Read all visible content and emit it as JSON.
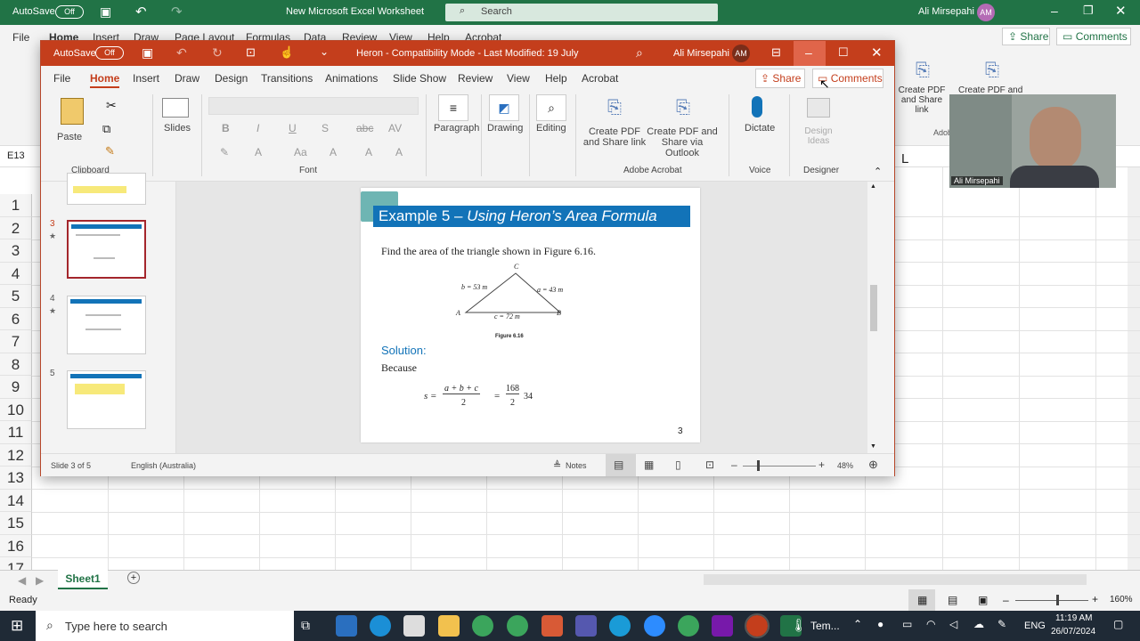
{
  "excel": {
    "autosave_label": "AutoSave",
    "autosave_state": "Off",
    "title": "New Microsoft Excel Worksheet",
    "search_placeholder": "Search",
    "user": "Ali Mirsepahi",
    "user_initials": "AM",
    "menu": [
      "File",
      "Home",
      "Insert",
      "Draw",
      "Page Layout",
      "Formulas",
      "Data",
      "Review",
      "View",
      "Help",
      "Acrobat"
    ],
    "share": "Share",
    "comments": "Comments",
    "acrobat_btn1": "Create PDF and Share link",
    "acrobat_btn2": "Create PDF and",
    "acrobat_group": "Adob",
    "name_box": "E13",
    "col_l": "L",
    "rows": [
      "1",
      "2",
      "3",
      "4",
      "5",
      "6",
      "7",
      "8",
      "9",
      "10",
      "11",
      "12",
      "13",
      "14",
      "15",
      "16",
      "17"
    ],
    "sheet_tab": "Sheet1",
    "status": "Ready",
    "zoom": "160%"
  },
  "ppt": {
    "autosave_label": "AutoSave",
    "autosave_state": "Off",
    "title": "Heron  -  Compatibility Mode  -  Last Modified: 19 July",
    "user": "Ali Mirsepahi",
    "user_initials": "AM",
    "tabs": [
      "File",
      "Home",
      "Insert",
      "Draw",
      "Design",
      "Transitions",
      "Animations",
      "Slide Show",
      "Review",
      "View",
      "Help",
      "Acrobat"
    ],
    "share": "Share",
    "comments": "Comments",
    "ribbon": {
      "paste": "Paste",
      "clipboard": "Clipboard",
      "slides": "Slides",
      "font": "Font",
      "paragraph": "Paragraph",
      "drawing": "Drawing",
      "editing": "Editing",
      "create_pdf_link": "Create PDF and Share link",
      "create_pdf_outlook": "Create PDF and Share via Outlook",
      "adobe_acrobat": "Adobe Acrobat",
      "dictate": "Dictate",
      "voice": "Voice",
      "design_ideas": "Design Ideas",
      "designer": "Designer"
    },
    "thumbs": [
      {
        "num": "3",
        "star": "★"
      },
      {
        "num": "4",
        "star": "★"
      },
      {
        "num": "5",
        "star": ""
      }
    ],
    "slide": {
      "heading_plain": "Example 5 – ",
      "heading_italic": "Using Heron’s Area Formula",
      "prompt": "Find the area of the triangle shown in Figure 6.16.",
      "label_c_vertex": "C",
      "label_a_vertex": "A",
      "label_b_vertex": "B",
      "side_b": "b = 53 m",
      "side_a": "a = 43 m",
      "side_c": "c = 72 m",
      "figure": "Figure 6.16",
      "solution": "Solution:",
      "because": "Because",
      "formula_s": "s =",
      "formula_num": "a + b + c",
      "formula_den": "2",
      "formula_eq": "=",
      "formula_num2": "168",
      "formula_den2": "2",
      "formula_result": "34",
      "page_number": "3"
    },
    "status_slide": "Slide 3 of 5",
    "status_lang": "English (Australia)",
    "notes": "Notes",
    "zoom": "48%"
  },
  "webcam_name": "Ali Mirsepahi",
  "taskbar": {
    "search": "Type here to search",
    "temp_label": "Tem...",
    "lang": "ENG",
    "time": "11:19 AM",
    "date": "26/07/2024"
  },
  "colors": {
    "excel_green": "#217346",
    "ppt_red": "#c43e1c",
    "slide_blue": "#1273b8"
  }
}
